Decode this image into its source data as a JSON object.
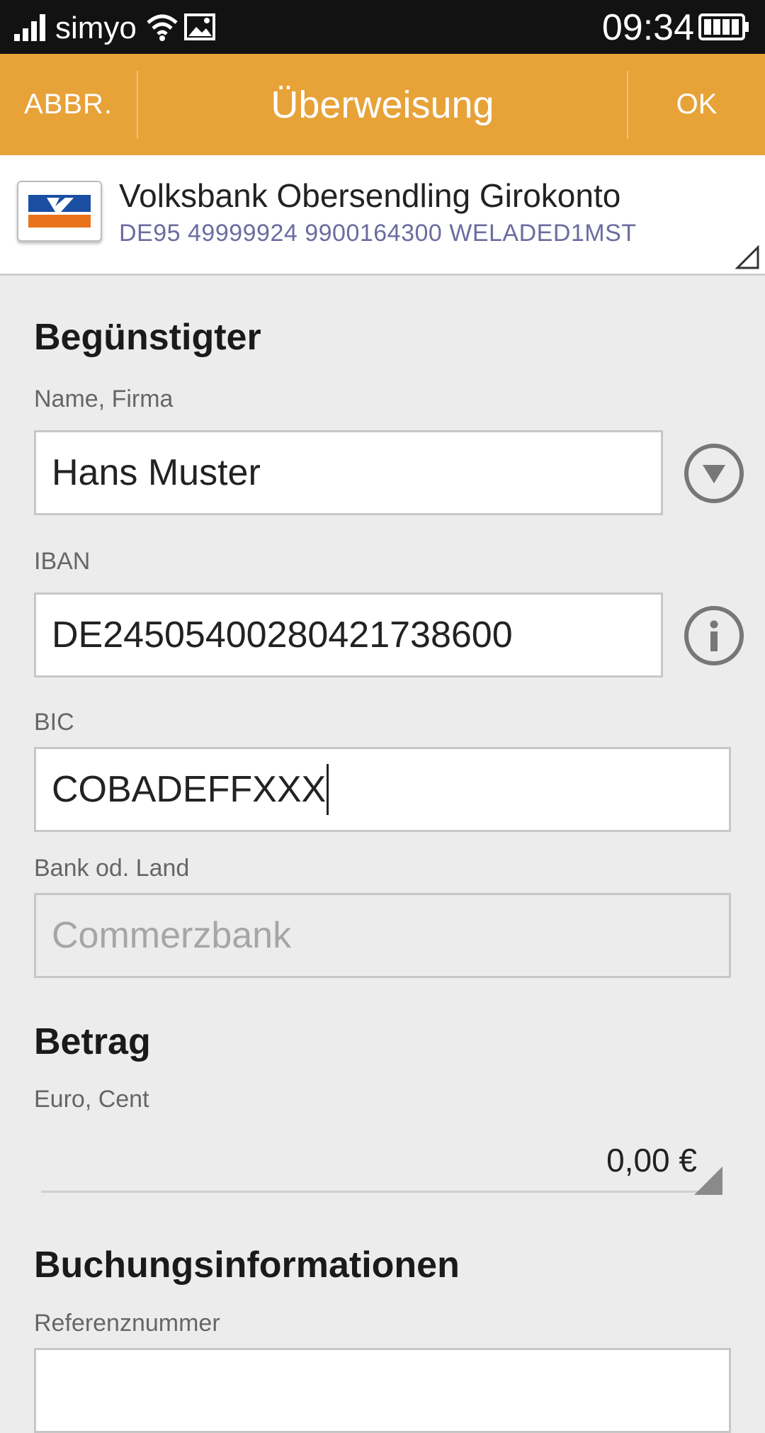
{
  "status_bar": {
    "carrier": "simyo",
    "time": "09:34"
  },
  "action_bar": {
    "cancel_label": "ABBR.",
    "title": "Überweisung",
    "ok_label": "OK"
  },
  "account": {
    "name": "Volksbank Obersendling Girokonto",
    "details": "DE95 49999924 9900164300 WELADED1MST"
  },
  "beneficiary": {
    "section_title": "Begünstigter",
    "name_label": "Name, Firma",
    "name_value": "Hans Muster",
    "iban_label": "IBAN",
    "iban_value": "DE24505400280421738600",
    "bic_label": "BIC",
    "bic_value": "COBADEFFXXX",
    "bank_label": "Bank od. Land",
    "bank_placeholder": "Commerzbank"
  },
  "amount": {
    "section_title": "Betrag",
    "label": "Euro, Cent",
    "value": "0,00 €"
  },
  "booking": {
    "section_title": "Buchungsinformationen",
    "reference_label": "Referenznummer"
  },
  "colors": {
    "action_bar": "#e7a238",
    "status_bar": "#121212",
    "background": "#ececec",
    "account_details": "#6c6ca0"
  }
}
